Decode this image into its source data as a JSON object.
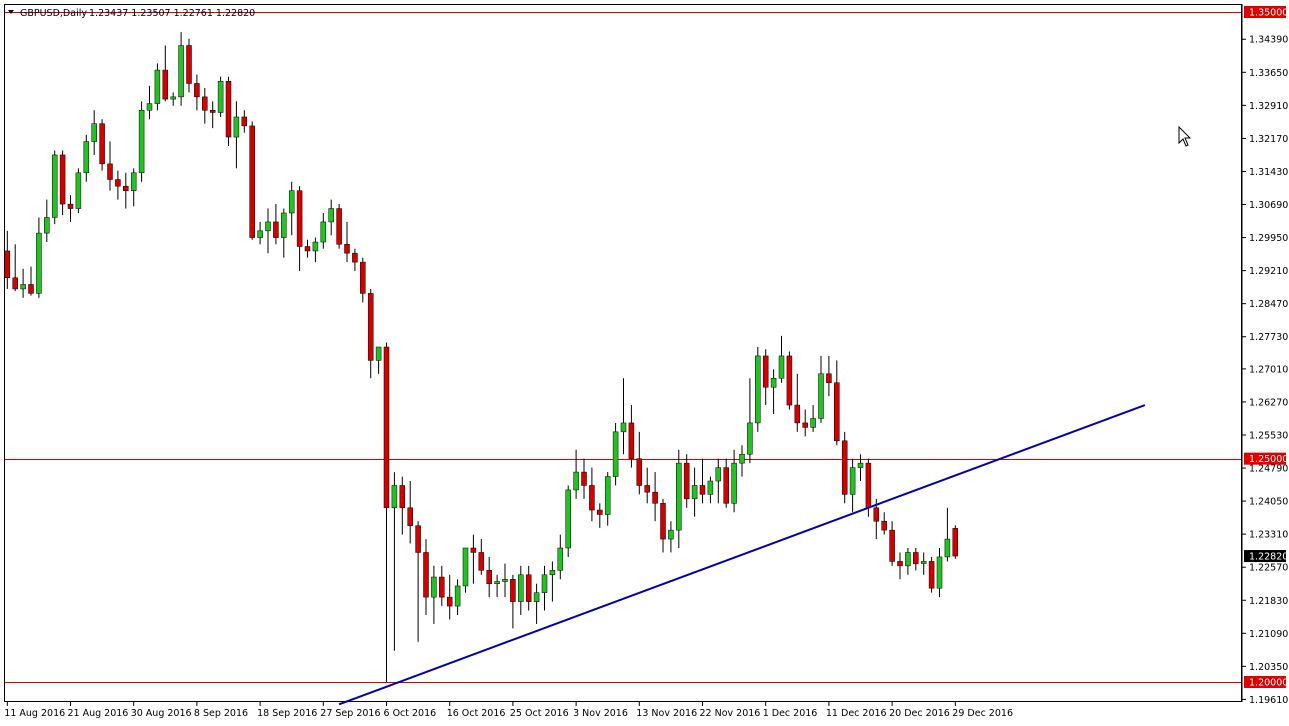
{
  "header": {
    "symbol": "GBPUSD,Daily",
    "ohlc": "1.23437 1.23507 1.22761 1.22820"
  },
  "colors": {
    "bull": "#22c222",
    "bear": "#d40000",
    "wick": "#000000",
    "hline": "#e00000",
    "trend": "#0000b0",
    "current_tag": "#000000"
  },
  "chart_data": {
    "type": "candlestick",
    "symbol": "GBPUSD",
    "timeframe": "Daily",
    "ylim": [
      1.1958,
      1.352
    ],
    "y_ticks": [
      "1.35000",
      "1.34390",
      "1.33650",
      "1.32910",
      "1.32170",
      "1.31430",
      "1.30690",
      "1.29950",
      "1.29210",
      "1.28470",
      "1.27730",
      "1.27010",
      "1.26270",
      "1.25530",
      "1.25000",
      "1.24790",
      "1.24050",
      "1.23310",
      "1.22820",
      "1.22570",
      "1.21830",
      "1.21090",
      "1.20350",
      "1.20000",
      "1.19610"
    ],
    "x_ticks": [
      "11 Aug 2016",
      "21 Aug 2016",
      "30 Aug 2016",
      "8 Sep 2016",
      "18 Sep 2016",
      "27 Sep 2016",
      "6 Oct 2016",
      "16 Oct 2016",
      "25 Oct 2016",
      "3 Nov 2016",
      "13 Nov 2016",
      "22 Nov 2016",
      "1 Dec 2016",
      "11 Dec 2016",
      "20 Dec 2016",
      "29 Dec 2016"
    ],
    "x_tick_index": [
      0,
      8,
      16,
      24,
      32,
      40,
      48,
      56,
      64,
      72,
      80,
      88,
      96,
      104,
      112,
      120
    ],
    "horizontal_lines": [
      {
        "value": 1.35,
        "label": "1.35000"
      },
      {
        "value": 1.25,
        "label": "1.25000"
      },
      {
        "value": 1.2,
        "label": "1.20000"
      }
    ],
    "current_price": {
      "value": 1.2282,
      "label": "1.22820"
    },
    "trendline": {
      "from": {
        "index": 42,
        "price": 1.195
      },
      "to": {
        "index": 144,
        "price": 1.262
      }
    },
    "candles": [
      [
        1.2965,
        1.301,
        1.288,
        1.2905
      ],
      [
        1.2905,
        1.298,
        1.2875,
        1.288
      ],
      [
        1.288,
        1.2925,
        1.286,
        1.289
      ],
      [
        1.289,
        1.293,
        1.2865,
        1.287
      ],
      [
        1.287,
        1.304,
        1.286,
        1.3005
      ],
      [
        1.3005,
        1.308,
        1.2985,
        1.304
      ],
      [
        1.304,
        1.319,
        1.3025,
        1.318
      ],
      [
        1.318,
        1.319,
        1.3045,
        1.307
      ],
      [
        1.307,
        1.309,
        1.303,
        1.306
      ],
      [
        1.306,
        1.315,
        1.305,
        1.314
      ],
      [
        1.314,
        1.3225,
        1.312,
        1.321
      ],
      [
        1.321,
        1.328,
        1.318,
        1.325
      ],
      [
        1.325,
        1.326,
        1.3145,
        1.316
      ],
      [
        1.316,
        1.321,
        1.31,
        1.3125
      ],
      [
        1.3125,
        1.3145,
        1.308,
        1.311
      ],
      [
        1.311,
        1.314,
        1.306,
        1.31
      ],
      [
        1.31,
        1.315,
        1.3065,
        1.314
      ],
      [
        1.314,
        1.33,
        1.312,
        1.328
      ],
      [
        1.328,
        1.3335,
        1.326,
        1.3295
      ],
      [
        1.3295,
        1.3385,
        1.328,
        1.337
      ],
      [
        1.337,
        1.3425,
        1.33,
        1.3305
      ],
      [
        1.3305,
        1.332,
        1.329,
        1.331
      ],
      [
        1.331,
        1.3455,
        1.329,
        1.3425
      ],
      [
        1.3425,
        1.344,
        1.332,
        1.334
      ],
      [
        1.334,
        1.336,
        1.328,
        1.331
      ],
      [
        1.331,
        1.333,
        1.325,
        1.328
      ],
      [
        1.328,
        1.33,
        1.324,
        1.3275
      ],
      [
        1.3275,
        1.3355,
        1.3265,
        1.3345
      ],
      [
        1.3345,
        1.3355,
        1.32,
        1.322
      ],
      [
        1.322,
        1.33,
        1.315,
        1.3265
      ],
      [
        1.3265,
        1.328,
        1.323,
        1.3245
      ],
      [
        1.3245,
        1.3255,
        1.299,
        1.2995
      ],
      [
        1.2995,
        1.303,
        1.298,
        1.301
      ],
      [
        1.301,
        1.306,
        1.296,
        1.303
      ],
      [
        1.303,
        1.307,
        1.298,
        1.2995
      ],
      [
        1.2995,
        1.306,
        1.295,
        1.305
      ],
      [
        1.305,
        1.312,
        1.3,
        1.31
      ],
      [
        1.31,
        1.311,
        1.292,
        1.2975
      ],
      [
        1.2975,
        1.299,
        1.295,
        1.2965
      ],
      [
        1.2965,
        1.2995,
        1.294,
        1.2985
      ],
      [
        1.2985,
        1.305,
        1.297,
        1.303
      ],
      [
        1.303,
        1.308,
        1.3,
        1.306
      ],
      [
        1.306,
        1.307,
        1.297,
        1.298
      ],
      [
        1.298,
        1.303,
        1.294,
        1.296
      ],
      [
        1.296,
        1.297,
        1.292,
        1.294
      ],
      [
        1.294,
        1.295,
        1.285,
        1.287
      ],
      [
        1.287,
        1.288,
        1.268,
        1.272
      ],
      [
        1.272,
        1.275,
        1.269,
        1.275
      ],
      [
        1.275,
        1.276,
        1.2,
        1.239
      ],
      [
        1.239,
        1.247,
        1.207,
        1.244
      ],
      [
        1.244,
        1.246,
        1.233,
        1.239
      ],
      [
        1.239,
        1.245,
        1.231,
        1.235
      ],
      [
        1.235,
        1.236,
        1.209,
        1.229
      ],
      [
        1.229,
        1.232,
        1.215,
        1.219
      ],
      [
        1.219,
        1.226,
        1.213,
        1.2235
      ],
      [
        1.2235,
        1.226,
        1.217,
        1.219
      ],
      [
        1.219,
        1.224,
        1.214,
        1.217
      ],
      [
        1.217,
        1.223,
        1.215,
        1.2215
      ],
      [
        1.2215,
        1.23,
        1.22,
        1.23
      ],
      [
        1.23,
        1.233,
        1.222,
        1.229
      ],
      [
        1.229,
        1.232,
        1.224,
        1.225
      ],
      [
        1.225,
        1.228,
        1.219,
        1.222
      ],
      [
        1.222,
        1.224,
        1.219,
        1.2225
      ],
      [
        1.2225,
        1.2265,
        1.219,
        1.223
      ],
      [
        1.223,
        1.224,
        1.212,
        1.218
      ],
      [
        1.218,
        1.226,
        1.215,
        1.224
      ],
      [
        1.224,
        1.226,
        1.216,
        1.218
      ],
      [
        1.218,
        1.222,
        1.213,
        1.22
      ],
      [
        1.22,
        1.226,
        1.216,
        1.224
      ],
      [
        1.224,
        1.227,
        1.218,
        1.225
      ],
      [
        1.225,
        1.233,
        1.223,
        1.23
      ],
      [
        1.23,
        1.244,
        1.228,
        1.243
      ],
      [
        1.243,
        1.252,
        1.241,
        1.247
      ],
      [
        1.247,
        1.25,
        1.241,
        1.244
      ],
      [
        1.244,
        1.248,
        1.236,
        1.2385
      ],
      [
        1.2385,
        1.24,
        1.2345,
        1.2375
      ],
      [
        1.2375,
        1.247,
        1.235,
        1.246
      ],
      [
        1.246,
        1.258,
        1.244,
        1.256
      ],
      [
        1.256,
        1.268,
        1.251,
        1.258
      ],
      [
        1.258,
        1.262,
        1.248,
        1.25
      ],
      [
        1.25,
        1.256,
        1.242,
        1.244
      ],
      [
        1.244,
        1.248,
        1.24,
        1.2425
      ],
      [
        1.2425,
        1.247,
        1.236,
        1.24
      ],
      [
        1.24,
        1.241,
        1.229,
        1.232
      ],
      [
        1.232,
        1.236,
        1.229,
        1.234
      ],
      [
        1.234,
        1.252,
        1.23,
        1.249
      ],
      [
        1.249,
        1.251,
        1.239,
        1.241
      ],
      [
        1.241,
        1.248,
        1.237,
        1.244
      ],
      [
        1.244,
        1.25,
        1.24,
        1.242
      ],
      [
        1.242,
        1.246,
        1.24,
        1.245
      ],
      [
        1.245,
        1.25,
        1.24,
        1.248
      ],
      [
        1.248,
        1.25,
        1.239,
        1.24
      ],
      [
        1.24,
        1.252,
        1.238,
        1.249
      ],
      [
        1.249,
        1.253,
        1.246,
        1.251
      ],
      [
        1.251,
        1.268,
        1.249,
        1.258
      ],
      [
        1.258,
        1.275,
        1.256,
        1.273
      ],
      [
        1.273,
        1.2745,
        1.262,
        1.266
      ],
      [
        1.266,
        1.27,
        1.26,
        1.268
      ],
      [
        1.268,
        1.2775,
        1.267,
        1.273
      ],
      [
        1.273,
        1.274,
        1.261,
        1.262
      ],
      [
        1.262,
        1.269,
        1.256,
        1.258
      ],
      [
        1.258,
        1.261,
        1.255,
        1.257
      ],
      [
        1.257,
        1.262,
        1.256,
        1.259
      ],
      [
        1.259,
        1.273,
        1.258,
        1.269
      ],
      [
        1.269,
        1.273,
        1.264,
        1.267
      ],
      [
        1.267,
        1.272,
        1.253,
        1.254
      ],
      [
        1.254,
        1.256,
        1.24,
        1.242
      ],
      [
        1.242,
        1.25,
        1.238,
        1.248
      ],
      [
        1.248,
        1.251,
        1.245,
        1.249
      ],
      [
        1.249,
        1.25,
        1.237,
        1.239
      ],
      [
        1.239,
        1.241,
        1.232,
        1.236
      ],
      [
        1.236,
        1.238,
        1.233,
        1.234
      ],
      [
        1.234,
        1.236,
        1.226,
        1.227
      ],
      [
        1.227,
        1.229,
        1.223,
        1.226
      ],
      [
        1.226,
        1.23,
        1.224,
        1.229
      ],
      [
        1.229,
        1.23,
        1.225,
        1.2265
      ],
      [
        1.2265,
        1.229,
        1.224,
        1.227
      ],
      [
        1.227,
        1.228,
        1.22,
        1.221
      ],
      [
        1.221,
        1.23,
        1.219,
        1.228
      ],
      [
        1.228,
        1.239,
        1.227,
        1.232
      ],
      [
        1.2344,
        1.2351,
        1.2276,
        1.2282
      ]
    ]
  }
}
